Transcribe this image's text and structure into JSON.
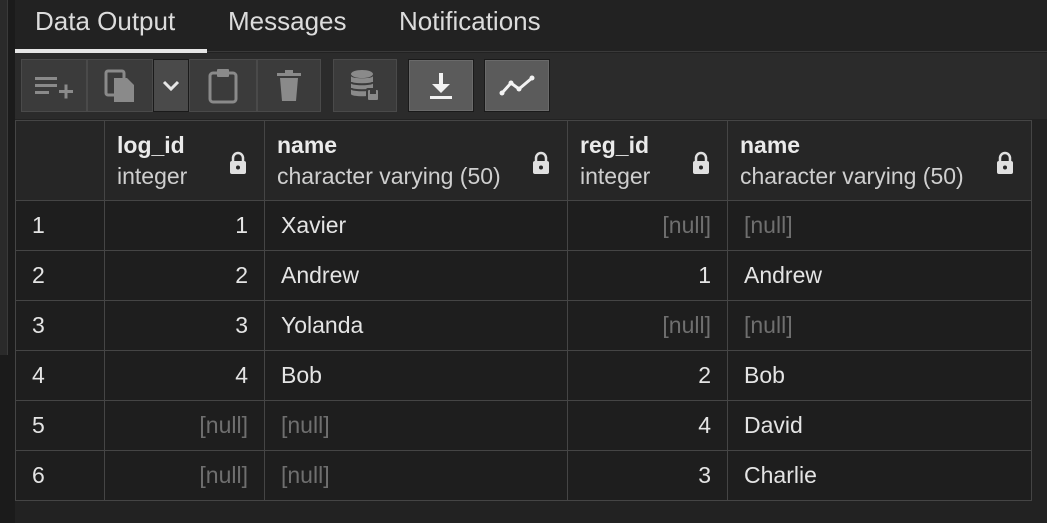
{
  "tabs": [
    {
      "label": "Data Output",
      "active": true
    },
    {
      "label": "Messages",
      "active": false
    },
    {
      "label": "Notifications",
      "active": false
    }
  ],
  "toolbar": {
    "buttons": [
      {
        "icon": "add-row-icon",
        "enabled": false
      },
      {
        "icon": "copy-icon",
        "enabled": false
      },
      {
        "icon": "chevron-down-icon",
        "enabled": true
      },
      {
        "icon": "paste-icon",
        "enabled": false
      },
      {
        "icon": "delete-icon",
        "enabled": false
      },
      {
        "icon": "save-data-icon",
        "enabled": false
      },
      {
        "icon": "download-icon",
        "enabled": true
      },
      {
        "icon": "graph-visualiser-icon",
        "enabled": true
      }
    ]
  },
  "grid": {
    "columns": [
      {
        "name": "log_id",
        "type": "integer",
        "align": "right"
      },
      {
        "name": "name",
        "type": "character varying (50)",
        "align": "left"
      },
      {
        "name": "reg_id",
        "type": "integer",
        "align": "right"
      },
      {
        "name": "name",
        "type": "character varying (50)",
        "align": "left"
      }
    ],
    "rows": [
      {
        "num": "1",
        "cells": [
          "1",
          "Xavier",
          "[null]",
          "[null]"
        ]
      },
      {
        "num": "2",
        "cells": [
          "2",
          "Andrew",
          "1",
          "Andrew"
        ]
      },
      {
        "num": "3",
        "cells": [
          "3",
          "Yolanda",
          "[null]",
          "[null]"
        ]
      },
      {
        "num": "4",
        "cells": [
          "4",
          "Bob",
          "2",
          "Bob"
        ]
      },
      {
        "num": "5",
        "cells": [
          "[null]",
          "[null]",
          "4",
          "David"
        ]
      },
      {
        "num": "6",
        "cells": [
          "[null]",
          "[null]",
          "3",
          "Charlie"
        ]
      }
    ]
  },
  "colors": {
    "background": "#1e1e1e",
    "header": "#262626",
    "border": "#454545",
    "null_text": "#6f6f6f"
  }
}
